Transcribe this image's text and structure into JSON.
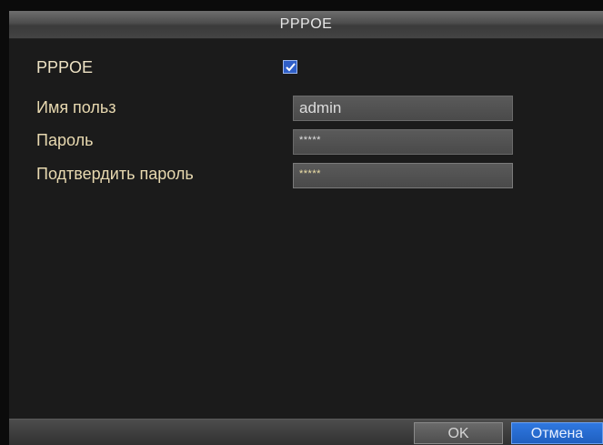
{
  "dialog": {
    "title": "PPPOE"
  },
  "form": {
    "pppoe_label": "PPPOE",
    "pppoe_enabled": true,
    "username_label": "Имя польз",
    "username_value": "admin",
    "password_label": "Пароль",
    "password_value": "*****",
    "confirm_label": "Подтвердить пароль",
    "confirm_value": "*****"
  },
  "buttons": {
    "ok": "OK",
    "cancel": "Отмена"
  },
  "icons": {
    "checkbox": "check-icon"
  },
  "colors": {
    "accent": "#2f78e0",
    "label": "#e8d9b0"
  }
}
